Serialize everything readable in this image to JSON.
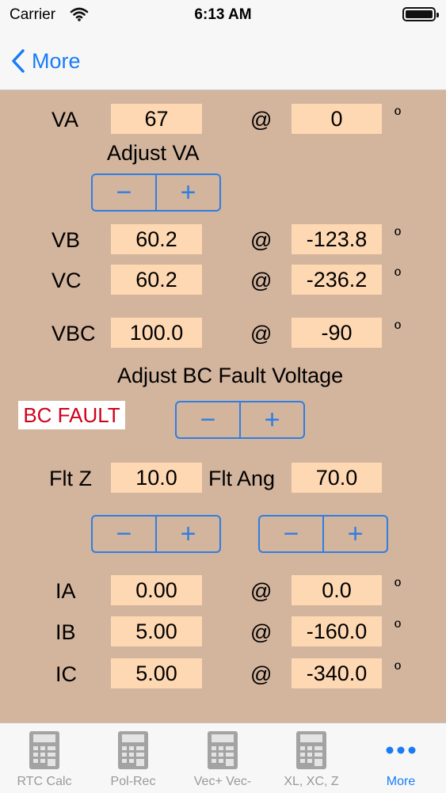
{
  "status": {
    "carrier": "Carrier",
    "time": "6:13 AM"
  },
  "nav": {
    "back_label": "More"
  },
  "deg_symbol": "º",
  "at_symbol": "@",
  "stepper": {
    "minus": "−",
    "plus": "+"
  },
  "va": {
    "label": "VA",
    "magnitude": "67",
    "angle": "0"
  },
  "adjust_va_label": "Adjust VA",
  "vb": {
    "label": "VB",
    "magnitude": "60.2",
    "angle": "-123.8"
  },
  "vc": {
    "label": "VC",
    "magnitude": "60.2",
    "angle": "-236.2"
  },
  "vbc": {
    "label": "VBC",
    "magnitude": "100.0",
    "angle": "-90"
  },
  "adjust_bc_label": "Adjust BC Fault Voltage",
  "fault_type": "BC FAULT",
  "flt_z": {
    "label": "Flt Z",
    "value": "10.0"
  },
  "flt_ang": {
    "label": "Flt Ang",
    "value": "70.0"
  },
  "ia": {
    "label": "IA",
    "magnitude": "0.00",
    "angle": "0.0"
  },
  "ib": {
    "label": "IB",
    "magnitude": "5.00",
    "angle": "-160.0"
  },
  "ic": {
    "label": "IC",
    "magnitude": "5.00",
    "angle": "-340.0"
  },
  "tabs": [
    {
      "label": "RTC Calc",
      "icon": "calculator-icon"
    },
    {
      "label": "Pol-Rec",
      "icon": "calculator-icon"
    },
    {
      "label": "Vec+ Vec-",
      "icon": "calculator-icon"
    },
    {
      "label": "XL, XC, Z",
      "icon": "calculator-icon"
    },
    {
      "label": "More",
      "icon": "more-dots-icon",
      "active": true
    }
  ],
  "colors": {
    "accent": "#1a7cf5",
    "background": "#d3b49d",
    "field": "#fed8b2",
    "fault_text": "#d0021b"
  }
}
